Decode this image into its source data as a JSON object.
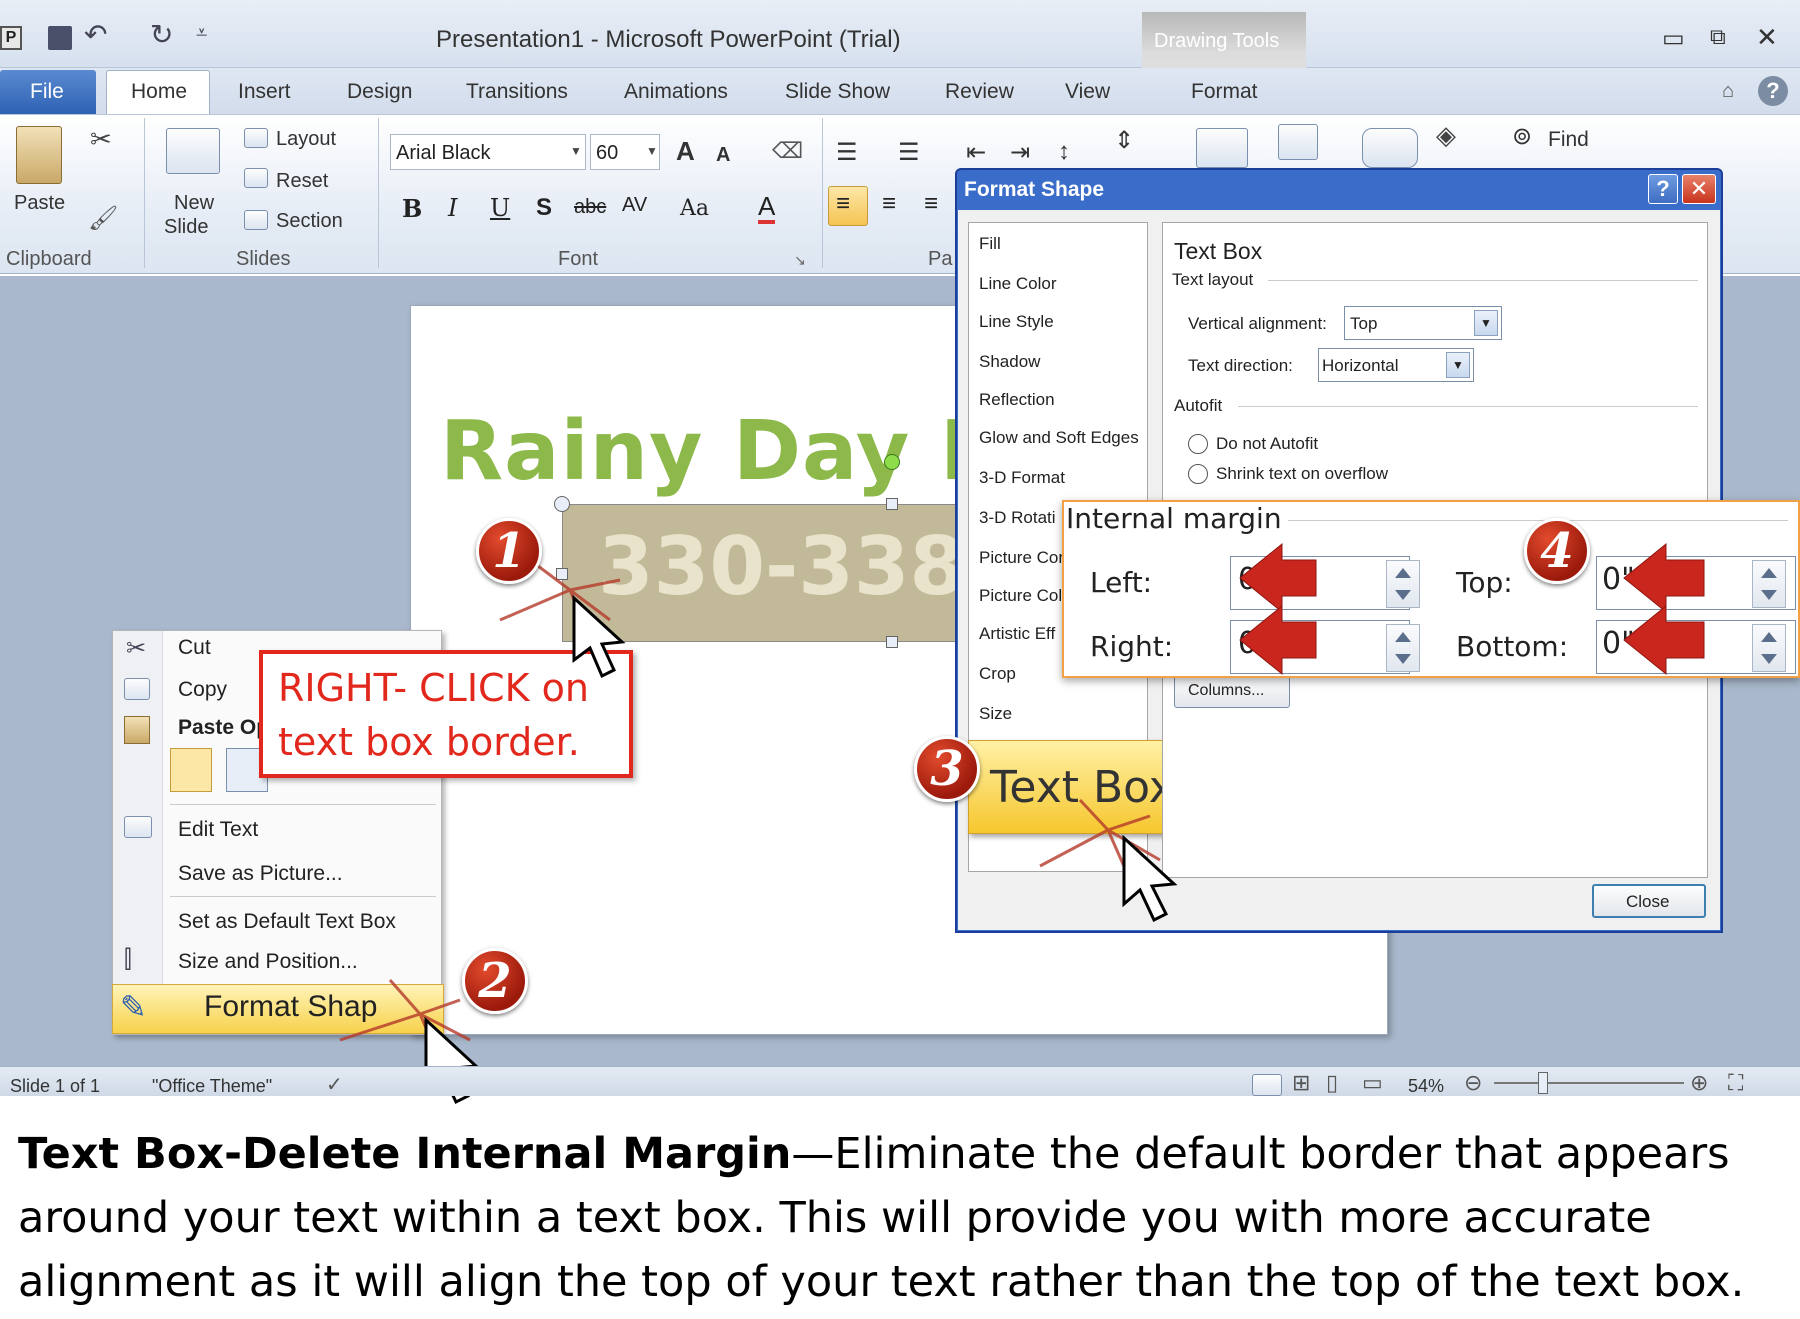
{
  "title_bar": {
    "title": "Presentation1  -  Microsoft PowerPoint (Trial)",
    "contextual_tab_group": "Drawing Tools"
  },
  "tabs": [
    "File",
    "Home",
    "Insert",
    "Design",
    "Transitions",
    "Animations",
    "Slide Show",
    "Review",
    "View",
    "Format"
  ],
  "ribbon": {
    "clipboard": {
      "paste": "Paste",
      "group": "Clipboard"
    },
    "slides": {
      "new_slide_1": "New",
      "new_slide_2": "Slide",
      "layout": "Layout",
      "reset": "Reset",
      "section": "Section",
      "group": "Slides"
    },
    "font": {
      "font_name": "Arial Black",
      "font_size": "60",
      "group": "Font"
    },
    "paragraph": {
      "group": "Pa"
    },
    "editing": {
      "find": "Find"
    }
  },
  "slide": {
    "title_text": "Rainy Day I",
    "phone_text": "330-338"
  },
  "context_menu": {
    "items": [
      "Cut",
      "Copy",
      "Paste Op",
      "Edit Text",
      "Save as Picture...",
      "Set as Default Text Box",
      "Size and Position...",
      "Format Shap"
    ]
  },
  "callout1": {
    "line1": "RIGHT- CLICK on",
    "line2": "text box border."
  },
  "badges": [
    "1",
    "2",
    "3",
    "4"
  ],
  "dialog": {
    "title": "Format Shape",
    "sidebar": [
      "Fill",
      "Line Color",
      "Line Style",
      "Shadow",
      "Reflection",
      "Glow and Soft Edges",
      "3-D Format",
      "3-D Rotati",
      "Picture Cor",
      "Picture Col",
      "Artistic Eff",
      "Crop",
      "Size",
      "Text Box"
    ],
    "section_title": "Text Box",
    "text_layout": "Text layout",
    "vertical_alignment_label": "Vertical alignment:",
    "vertical_alignment_value": "Top",
    "text_direction_label": "Text direction:",
    "text_direction_value": "Horizontal",
    "autofit": "Autofit",
    "do_not_autofit": "Do not Autofit",
    "shrink_text": "Shrink text on overflow",
    "columns_button": "Columns...",
    "close_button": "Close"
  },
  "internal_margin": {
    "title": "Internal margin",
    "left_label": "Left:",
    "left_value": "0\"",
    "right_label": "Right:",
    "right_value": "0\"",
    "top_label": "Top:",
    "top_value": "0\"",
    "bottom_label": "Bottom:",
    "bottom_value": "0\""
  },
  "text_box_callout": "Text Box",
  "status_bar": {
    "slide": "Slide 1 of 1",
    "theme": "\"Office Theme\"",
    "zoom": "54%"
  },
  "caption": {
    "bold": "Text Box-Delete Internal Margin",
    "rest": "—Eliminate the default border that appears around your text within a text box.  This will provide you with more accurate alignment as it will align the top of your text rather than the top of the text box."
  },
  "colors": {
    "accent_red": "#e2281c",
    "slide_green": "#8db84a",
    "phone_box": "#c2b998",
    "dialog_blue": "#3a6cc9"
  }
}
